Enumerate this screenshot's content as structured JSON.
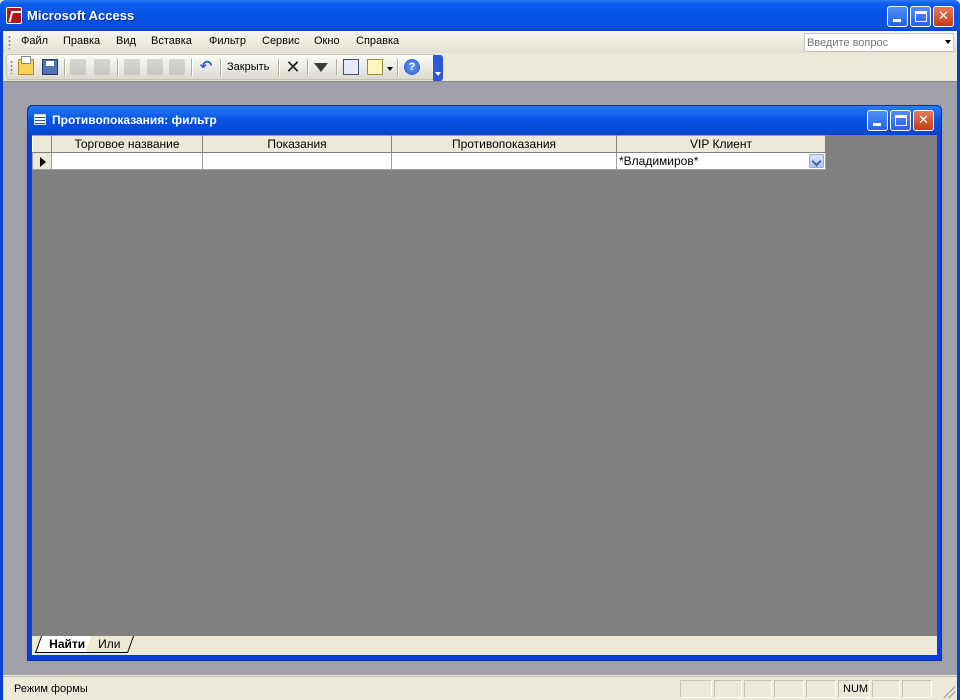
{
  "app": {
    "title": "Microsoft Access"
  },
  "menu": {
    "items": [
      "Файл",
      "Правка",
      "Вид",
      "Вставка",
      "Фильтр",
      "Сервис",
      "Окно",
      "Справка"
    ]
  },
  "help_search": {
    "placeholder": "Введите вопрос"
  },
  "toolbar": {
    "close_label": "Закрыть",
    "icons": [
      "open-folder-icon",
      "save-icon",
      "print-icon",
      "spelling-icon",
      "cut-icon",
      "copy-icon",
      "paste-icon",
      "undo-icon",
      "delete-icon",
      "apply-filter-icon",
      "database-window-icon",
      "new-object-icon",
      "help-icon"
    ]
  },
  "child_window": {
    "title": "Противопоказания: фильтр"
  },
  "grid": {
    "columns": [
      "Торговое название",
      "Показания",
      "Противопоказания",
      "VIP Клиент"
    ],
    "row": [
      "",
      "",
      "",
      "*Владимиров*"
    ]
  },
  "tabs": {
    "find": "Найти",
    "or": "Или"
  },
  "status": {
    "mode": "Режим формы",
    "num": "NUM"
  },
  "colors": {
    "title_blue": "#0a3fd8",
    "mdi_background": "#a0a0a8",
    "datasheet_background": "#808080"
  }
}
